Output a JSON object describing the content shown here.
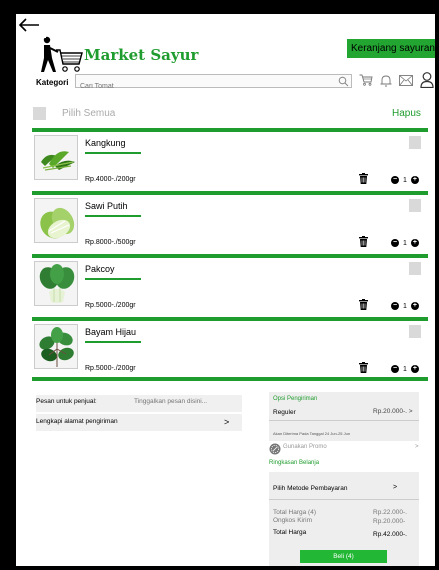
{
  "header": {
    "app_title": "Market Sayur",
    "subtitle": "Belanja grosir lebih murah",
    "cart_button": "Keranjang sayuran"
  },
  "search": {
    "category_label": "Kategori",
    "placeholder": "Cari Tomat"
  },
  "selection": {
    "select_all": "Pilih Semua",
    "delete": "Hapus"
  },
  "items": [
    {
      "name": "Kangkung",
      "price": "Rp.4000-./200gr",
      "qty": "1"
    },
    {
      "name": "Sawi Putih",
      "price": "Rp.8000-./500gr",
      "qty": "1"
    },
    {
      "name": "Pakcoy",
      "price": "Rp.5000-./200gr",
      "qty": "1"
    },
    {
      "name": "Bayam Hijau",
      "price": "Rp.5000-./200gr",
      "qty": "1"
    }
  ],
  "message": {
    "label": "Pesan untuk penjual:",
    "placeholder": "Tinggalkan pesan disini..."
  },
  "address": {
    "label": "Lengkapi alamat pengiriman",
    "arrow": ">"
  },
  "shipping": {
    "title": "Opsi Pengiriman",
    "method": "Reguler",
    "price": "Rp.20.000-. >",
    "eta": "Akan Diterima Pada Tanggal 24 Jun-25 Jun"
  },
  "promo": {
    "label": "Gunakan Promo",
    "arrow": ">"
  },
  "summary": {
    "title": "Ringkasan Belanja",
    "payment_label": "Pilih Metode Pembayaran",
    "payment_arrow": ">",
    "total_price_label": "Total Harga (4)",
    "total_price_value": "Rp.22.000-.",
    "shipping_label": "Ongkos Kirim",
    "shipping_value": "Rp.20.000-",
    "total_label": "Total Harga",
    "total_value": "Rp.42.000-.",
    "buy_button": "Beli (4)"
  },
  "colors": {
    "accent": "#1f9c2e",
    "button": "#22a531"
  }
}
